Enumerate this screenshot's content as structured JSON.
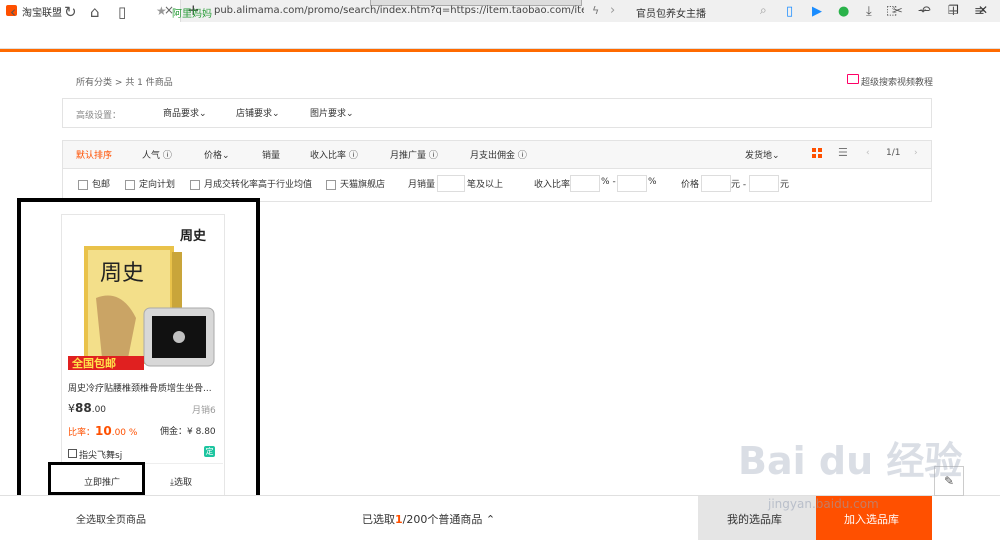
{
  "browser": {
    "tab_title": "淘宝联盟",
    "tab_close": "×",
    "new_tab": "+",
    "window_controls": [
      "⬚",
      "—",
      "❐",
      "✕"
    ],
    "nav": {
      "back": "‹",
      "forward": "›",
      "reload": "↻",
      "home": "⌂",
      "reader": "▯"
    },
    "secure_label": "阿里妈妈",
    "url": "pub.alimama.com/promo/search/index.htm?q=https://item.taobao.com/item.htm",
    "search_text": "官员包养女主播",
    "toolbar_icons": [
      "phone-icon",
      "play-icon",
      "chat-icon",
      "download-icon",
      "scissors-icon",
      "undo-icon",
      "plus-icon",
      "menu-icon"
    ]
  },
  "breadcrumb": {
    "all": "所有分类",
    "sep": ">",
    "count": "共 1 件商品"
  },
  "video_tutorial": "超级搜索视频教程",
  "advanced": {
    "label": "高级设置：",
    "items": [
      "商品要求",
      "店铺要求",
      "图片要求"
    ]
  },
  "sort": {
    "items": [
      "默认排序",
      "人气",
      "价格",
      "销量",
      "收入比率",
      "月推广量",
      "月支出佣金"
    ],
    "ship_from": "发货地",
    "page": "1/1"
  },
  "filters": {
    "checkboxes": [
      "包邮",
      "定向计划",
      "月成交转化率高于行业均值",
      "天猫旗舰店"
    ],
    "monthly_sales_label": "月销量",
    "monthly_sales_suffix": "笔及以上",
    "ratio_label": "收入比率",
    "percent": "%",
    "dash": "-",
    "price_label": "价格",
    "yuan": "元"
  },
  "product": {
    "brand": "周史",
    "badge": "全国包邮",
    "title": "周史冷疗贴腰椎颈椎骨质增生坐骨...",
    "currency": "¥",
    "price": "88",
    "price_dec": ".00",
    "sales": "月销6",
    "rate_label": "比率：",
    "rate": "10",
    "rate_dec": ".00 %",
    "commission_label": "佣金：",
    "commission": "¥ 8.80",
    "shop": "指尖飞舞sj",
    "ding": "定",
    "promote": "立即推广",
    "pick": "选取"
  },
  "bottom": {
    "select_all": "全选取全页商品",
    "selected_prefix": "已选取",
    "selected_count": "1",
    "selected_suffix": "/200个普通商品",
    "my_library": "我的选品库",
    "add_library": "加入选品库"
  },
  "watermark": {
    "main": "Bai du 经验",
    "sub": "jingyan.baidu.com"
  },
  "colors": {
    "accent": "#ff5000",
    "ding": "#1dc5a0"
  }
}
